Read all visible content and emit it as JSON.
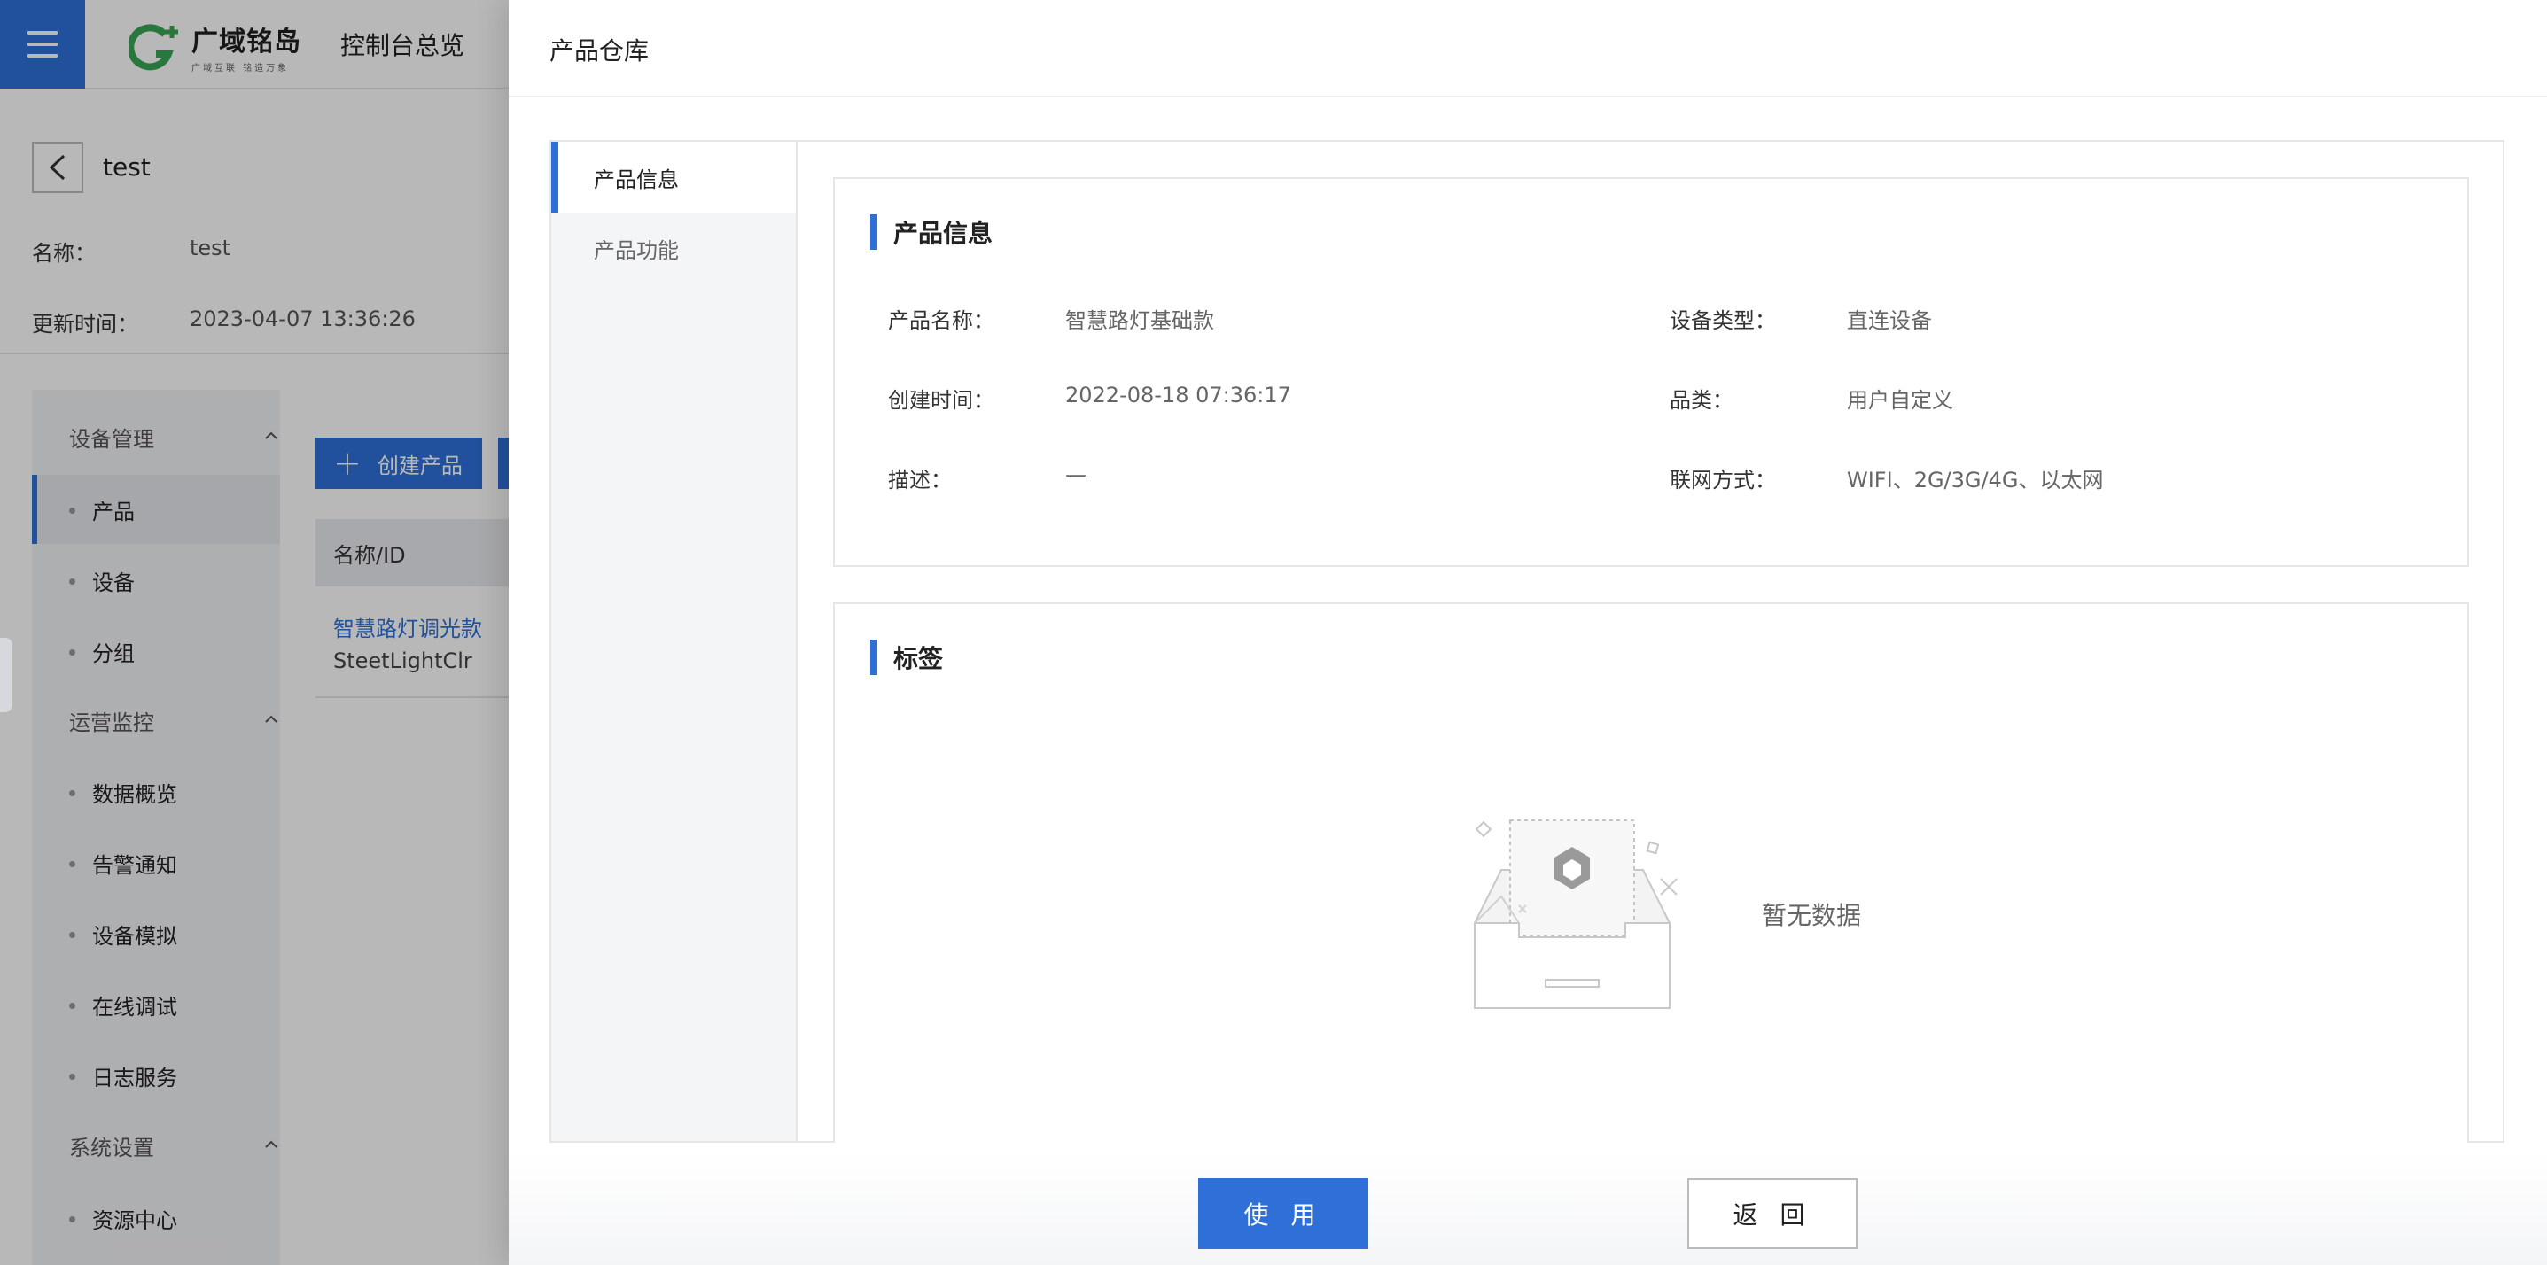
{
  "topbar": {
    "logo_name": "广域铭岛",
    "logo_slogan": "广域互联 铭造万象",
    "console_title": "控制台总览",
    "menu_icon": "hamburger-icon",
    "brand_color": "#2f6fd8"
  },
  "detail": {
    "name": "test",
    "fields": [
      {
        "label": "名称：",
        "value": "test"
      },
      {
        "label": "更新时间：",
        "value": "2023-04-07 13:36:26"
      }
    ]
  },
  "side_menu": {
    "groups": [
      {
        "label": "设备管理",
        "items": [
          "产品",
          "设备",
          "分组"
        ]
      },
      {
        "label": "运营监控",
        "items": [
          "数据概览",
          "告警通知",
          "设备模拟",
          "在线调试",
          "日志服务"
        ]
      },
      {
        "label": "系统设置",
        "items": [
          "资源中心"
        ]
      }
    ],
    "active_item": "产品"
  },
  "product_list": {
    "create_label": "创建产品",
    "column_header": "名称/ID",
    "rows": [
      {
        "name": "智慧路灯调光款",
        "id": "SteetLightClr"
      }
    ]
  },
  "drawer": {
    "title": "产品仓库",
    "tabs": [
      "产品信息",
      "产品功能"
    ],
    "active_tab": "产品信息",
    "info_card": {
      "title": "产品信息",
      "fields": [
        {
          "label": "产品名称：",
          "value": "智慧路灯基础款"
        },
        {
          "label": "设备类型：",
          "value": "直连设备"
        },
        {
          "label": "创建时间：",
          "value": "2022-08-18 07:36:17"
        },
        {
          "label": "品类：",
          "value": "用户自定义"
        },
        {
          "label": "描述：",
          "value": "—"
        },
        {
          "label": "联网方式：",
          "value": "WIFI、2G/3G/4G、以太网"
        }
      ]
    },
    "tag_card": {
      "title": "标签",
      "empty_text": "暂无数据"
    },
    "buttons": {
      "use": "使 用",
      "back": "返 回"
    }
  }
}
